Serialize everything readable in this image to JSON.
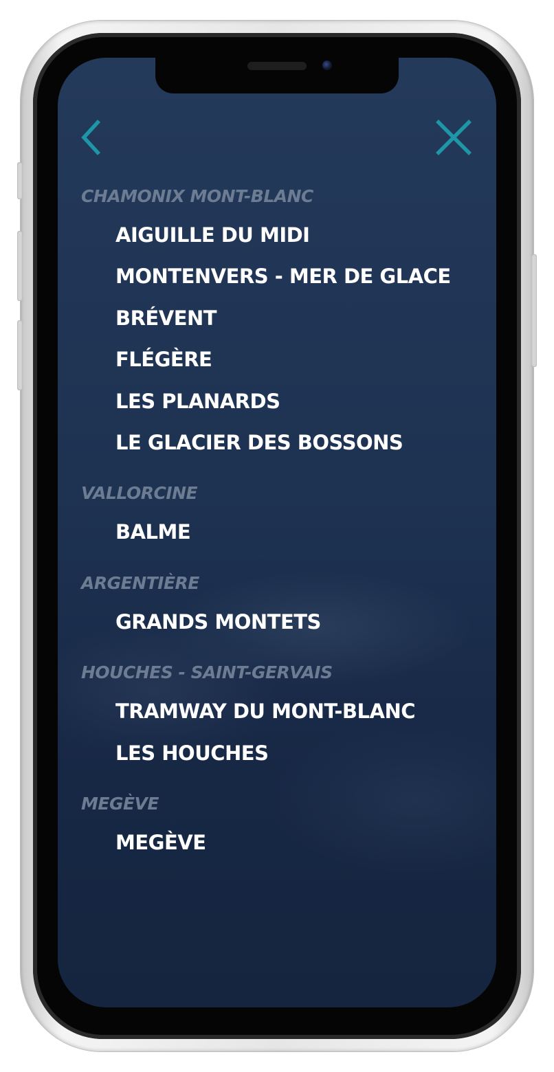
{
  "icons": {
    "back": "chevron-left-icon",
    "close": "close-icon",
    "accent": "#1e96a8"
  },
  "colors": {
    "background": "#1e3252",
    "section_title": "#6b7c93",
    "item_text": "#ffffff"
  },
  "sections": [
    {
      "title": "CHAMONIX MONT-BLANC",
      "items": [
        "AIGUILLE DU MIDI",
        "MONTENVERS - MER DE GLACE",
        "BRÉVENT",
        "FLÉGÈRE",
        "LES PLANARDS",
        "LE GLACIER DES BOSSONS"
      ]
    },
    {
      "title": "VALLORCINE",
      "items": [
        "BALME"
      ]
    },
    {
      "title": "ARGENTIÈRE",
      "items": [
        "GRANDS MONTETS"
      ]
    },
    {
      "title": "HOUCHES - SAINT-GERVAIS",
      "items": [
        "TRAMWAY DU MONT-BLANC",
        "LES HOUCHES"
      ]
    },
    {
      "title": "MEGÈVE",
      "items": [
        "MEGÈVE"
      ]
    }
  ]
}
